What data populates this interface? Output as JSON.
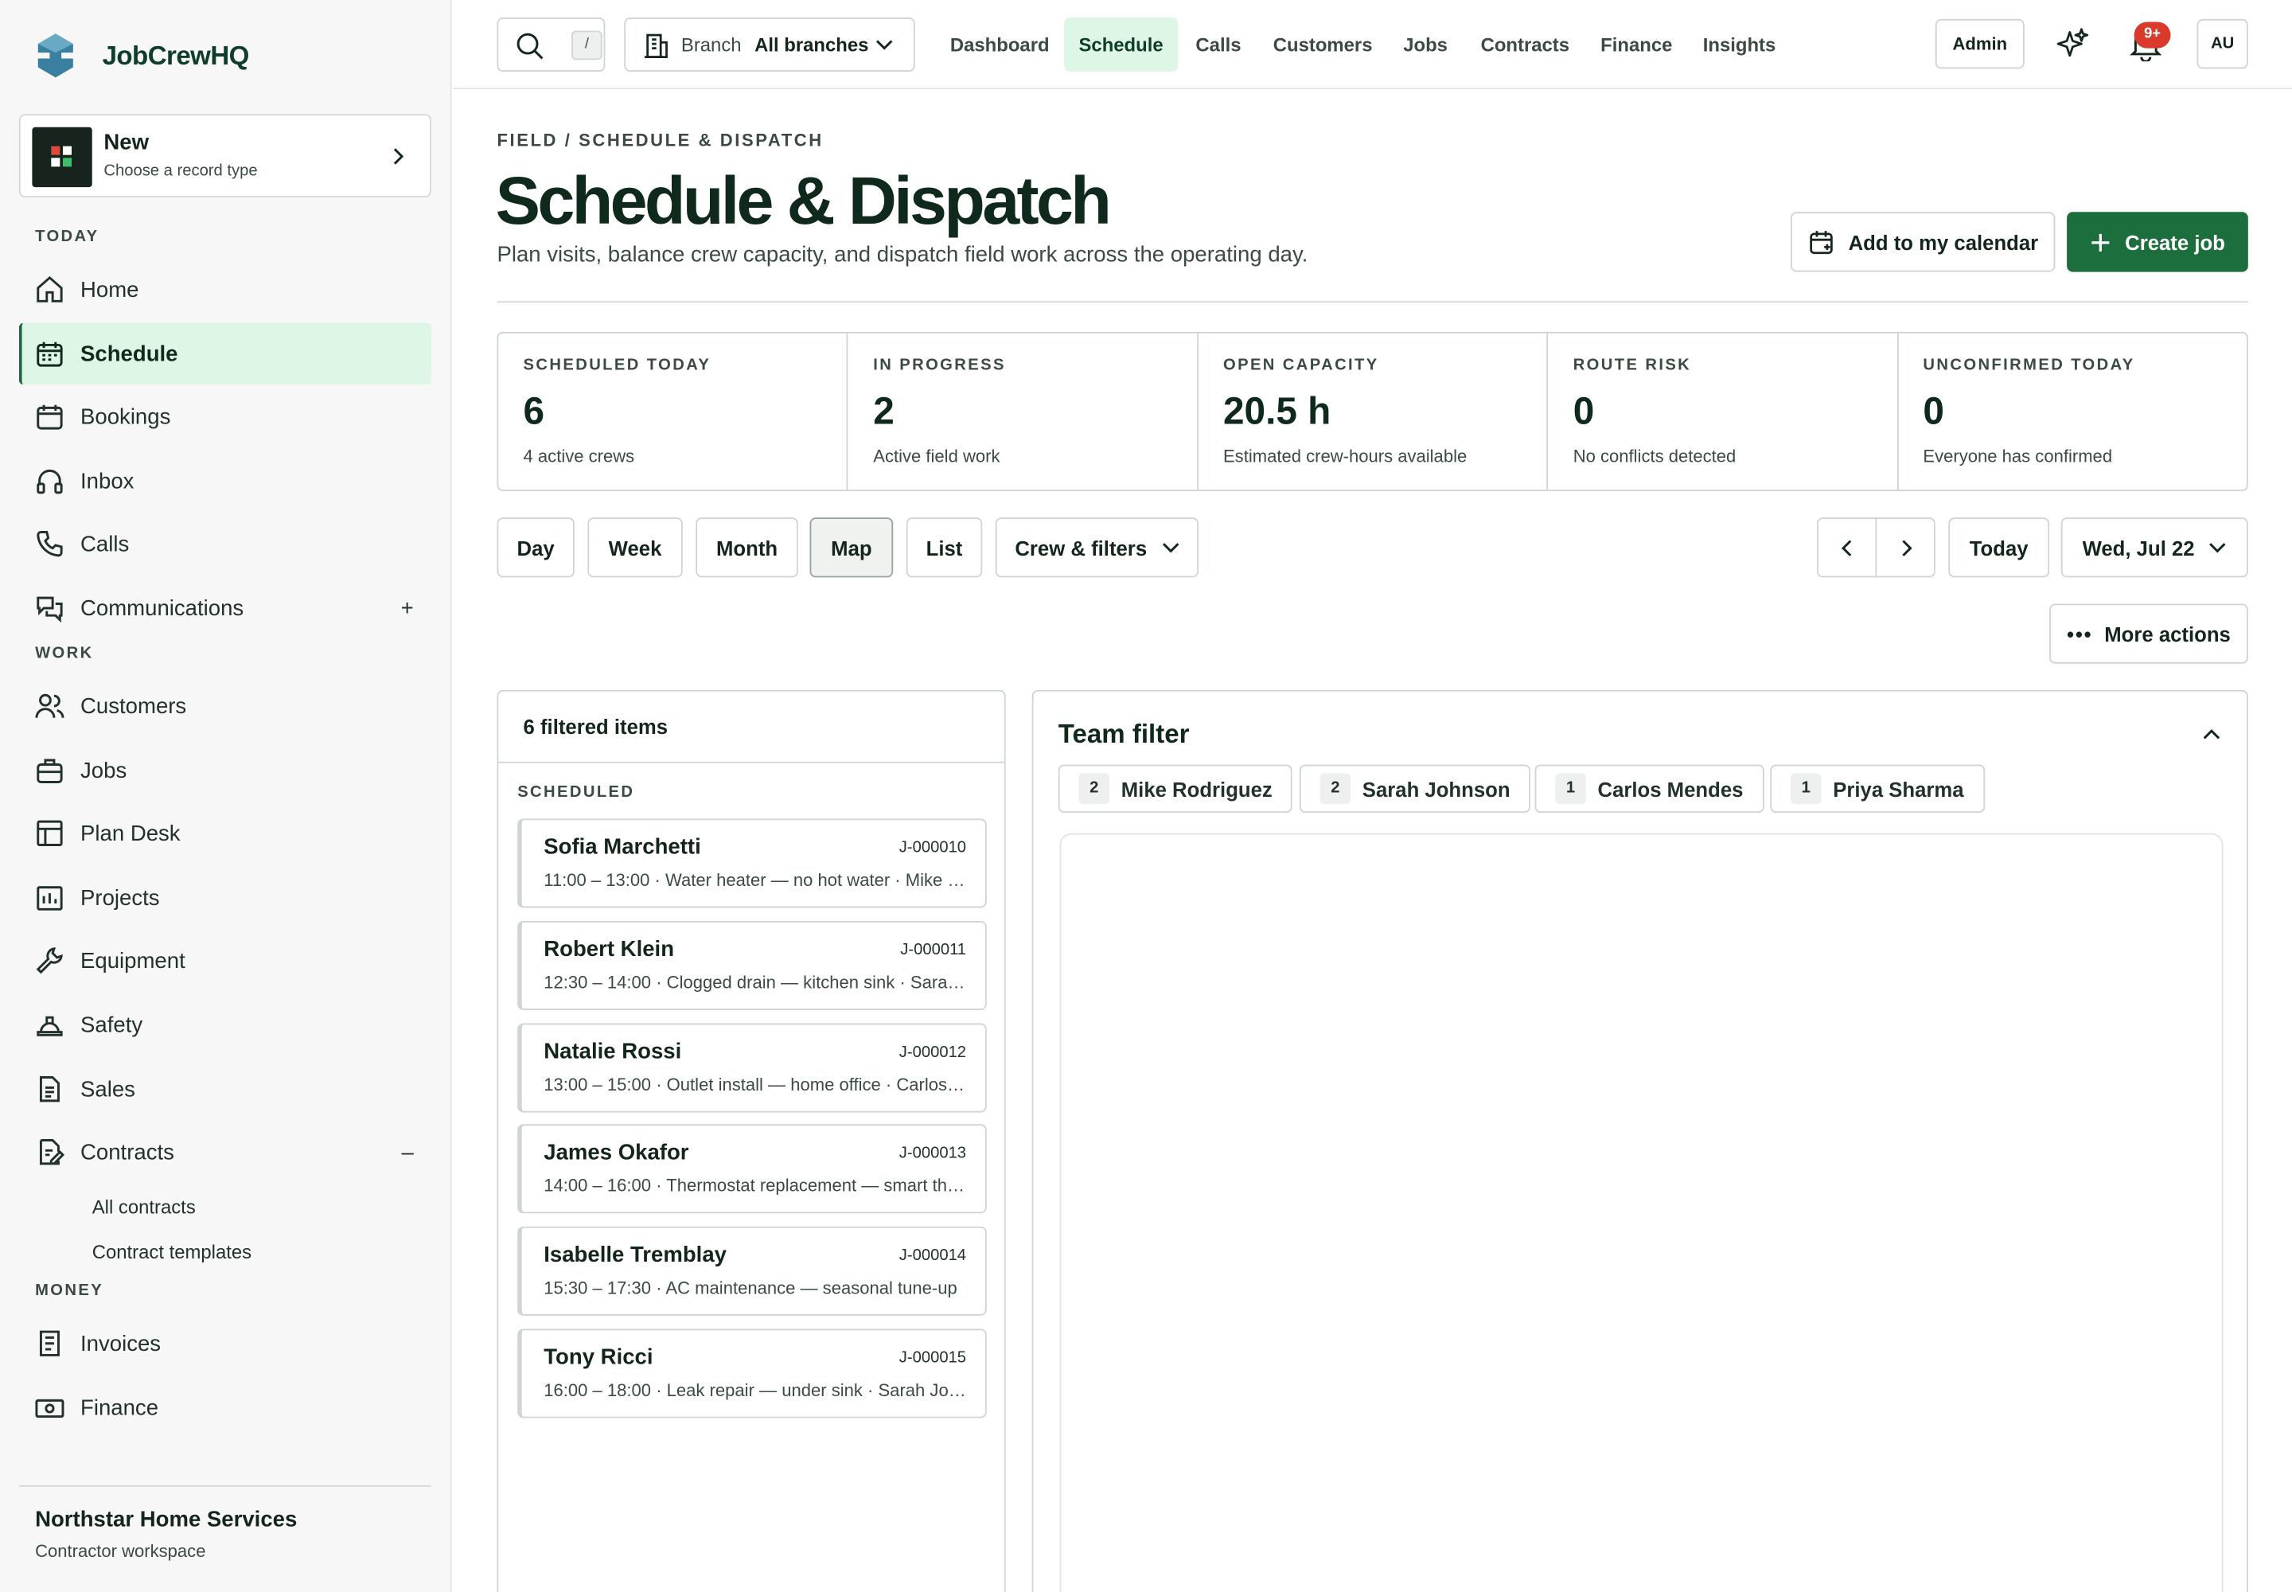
{
  "brand": {
    "name": "JobCrewHQ"
  },
  "new_card": {
    "title": "New",
    "subtitle": "Choose a record type"
  },
  "sidebar": {
    "sections": {
      "today": "TODAY",
      "work": "WORK",
      "money": "MONEY"
    },
    "today": [
      {
        "label": "Home"
      },
      {
        "label": "Schedule"
      },
      {
        "label": "Bookings"
      },
      {
        "label": "Inbox"
      },
      {
        "label": "Calls"
      },
      {
        "label": "Communications"
      }
    ],
    "work": [
      {
        "label": "Customers"
      },
      {
        "label": "Jobs"
      },
      {
        "label": "Plan Desk"
      },
      {
        "label": "Projects"
      },
      {
        "label": "Equipment"
      },
      {
        "label": "Safety"
      },
      {
        "label": "Sales"
      },
      {
        "label": "Contracts"
      }
    ],
    "contracts_sub": [
      {
        "label": "All contracts"
      },
      {
        "label": "Contract templates"
      }
    ],
    "money": [
      {
        "label": "Invoices"
      },
      {
        "label": "Finance"
      }
    ],
    "org": {
      "name": "Northstar Home Services",
      "sub": "Contractor workspace"
    }
  },
  "topbar": {
    "search_kbd": "/",
    "branch_label": "Branch",
    "branch_value": "All branches",
    "nav": [
      {
        "label": "Dashboard"
      },
      {
        "label": "Schedule"
      },
      {
        "label": "Calls"
      },
      {
        "label": "Customers"
      },
      {
        "label": "Jobs"
      },
      {
        "label": "Contracts"
      },
      {
        "label": "Finance"
      },
      {
        "label": "Insights"
      }
    ],
    "admin": "Admin",
    "notif_badge": "9+",
    "avatar": "AU"
  },
  "page": {
    "breadcrumb": "FIELD / SCHEDULE & DISPATCH",
    "title": "Schedule & Dispatch",
    "subtitle": "Plan visits, balance crew capacity, and dispatch field work across the operating day.",
    "add_calendar": "Add to my calendar",
    "create_job": "Create job"
  },
  "stats": [
    {
      "label": "SCHEDULED TODAY",
      "value": "6",
      "sub": "4 active crews"
    },
    {
      "label": "IN PROGRESS",
      "value": "2",
      "sub": "Active field work"
    },
    {
      "label": "OPEN CAPACITY",
      "value": "20.5 h",
      "sub": "Estimated crew-hours available"
    },
    {
      "label": "ROUTE RISK",
      "value": "0",
      "sub": "No conflicts detected"
    },
    {
      "label": "UNCONFIRMED TODAY",
      "value": "0",
      "sub": "Everyone has confirmed"
    }
  ],
  "views": {
    "day": "Day",
    "week": "Week",
    "month": "Month",
    "map": "Map",
    "list": "List",
    "filters": "Crew & filters",
    "today": "Today",
    "date": "Wed, Jul 22",
    "more": "More actions"
  },
  "list": {
    "count_label": "6 filtered items",
    "group": "SCHEDULED",
    "jobs": [
      {
        "name": "Sofia Marchetti",
        "id": "J-000010",
        "desc": "11:00 – 13:00 · Water heater — no hot water · Mike Rodriguez"
      },
      {
        "name": "Robert Klein",
        "id": "J-000011",
        "desc": "12:30 – 14:00 · Clogged drain — kitchen sink · Sarah Johnson"
      },
      {
        "name": "Natalie Rossi",
        "id": "J-000012",
        "desc": "13:00 – 15:00 · Outlet install — home office · Carlos Mendes"
      },
      {
        "name": "James Okafor",
        "id": "J-000013",
        "desc": "14:00 – 16:00 · Thermostat replacement — smart thermostat"
      },
      {
        "name": "Isabelle Tremblay",
        "id": "J-000014",
        "desc": "15:30 – 17:30 · AC maintenance — seasonal tune-up"
      },
      {
        "name": "Tony Ricci",
        "id": "J-000015",
        "desc": "16:00 – 18:00 · Leak repair — under sink · Sarah Johnson"
      }
    ]
  },
  "team_filter": {
    "title": "Team filter",
    "members": [
      {
        "count": "2",
        "name": "Mike Rodriguez"
      },
      {
        "count": "2",
        "name": "Sarah Johnson"
      },
      {
        "count": "1",
        "name": "Carlos Mendes"
      },
      {
        "count": "1",
        "name": "Priya Sharma"
      }
    ]
  },
  "colors": {
    "accent": "#1d6e3d",
    "active_bg": "#def6e6",
    "badge": "#d93a2b"
  }
}
